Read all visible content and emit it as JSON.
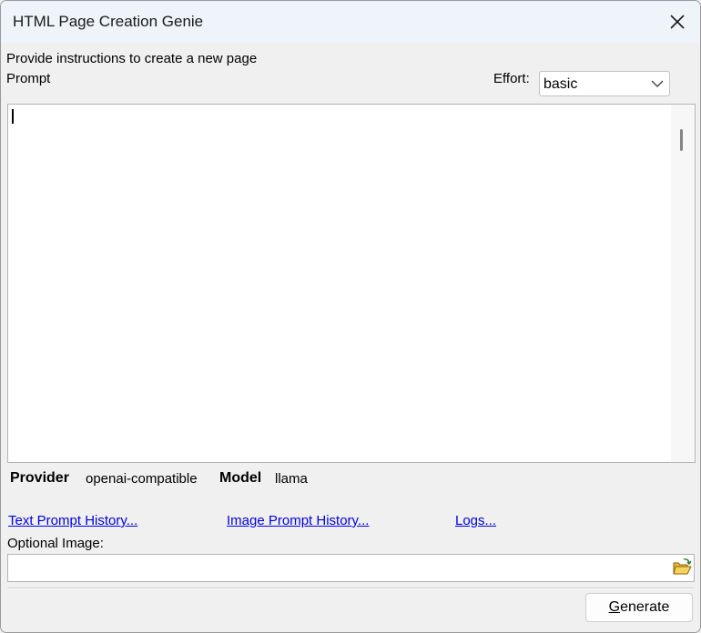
{
  "window": {
    "title": "HTML Page Creation Genie"
  },
  "form": {
    "instructions": "Provide instructions to create a new page",
    "prompt_label": "Prompt",
    "effort_label": "Effort:",
    "effort_value": "basic",
    "prompt_text": ""
  },
  "info": {
    "provider_label": "Provider",
    "provider_value": "openai-compatible",
    "model_label": "Model",
    "model_value": "llama"
  },
  "links": {
    "text_history": "Text Prompt History...",
    "image_history": "Image Prompt History...",
    "logs": "Logs..."
  },
  "image": {
    "label": "Optional Image:",
    "value": ""
  },
  "actions": {
    "generate_accel": "G",
    "generate_rest": "enerate"
  },
  "icons": {
    "close": "close-icon",
    "chevron": "chevron-down-icon",
    "browse": "folder-open-icon"
  },
  "colors": {
    "titlebar": "#eef4f9",
    "dialog": "#f0f0f0",
    "link": "#0000ee"
  }
}
